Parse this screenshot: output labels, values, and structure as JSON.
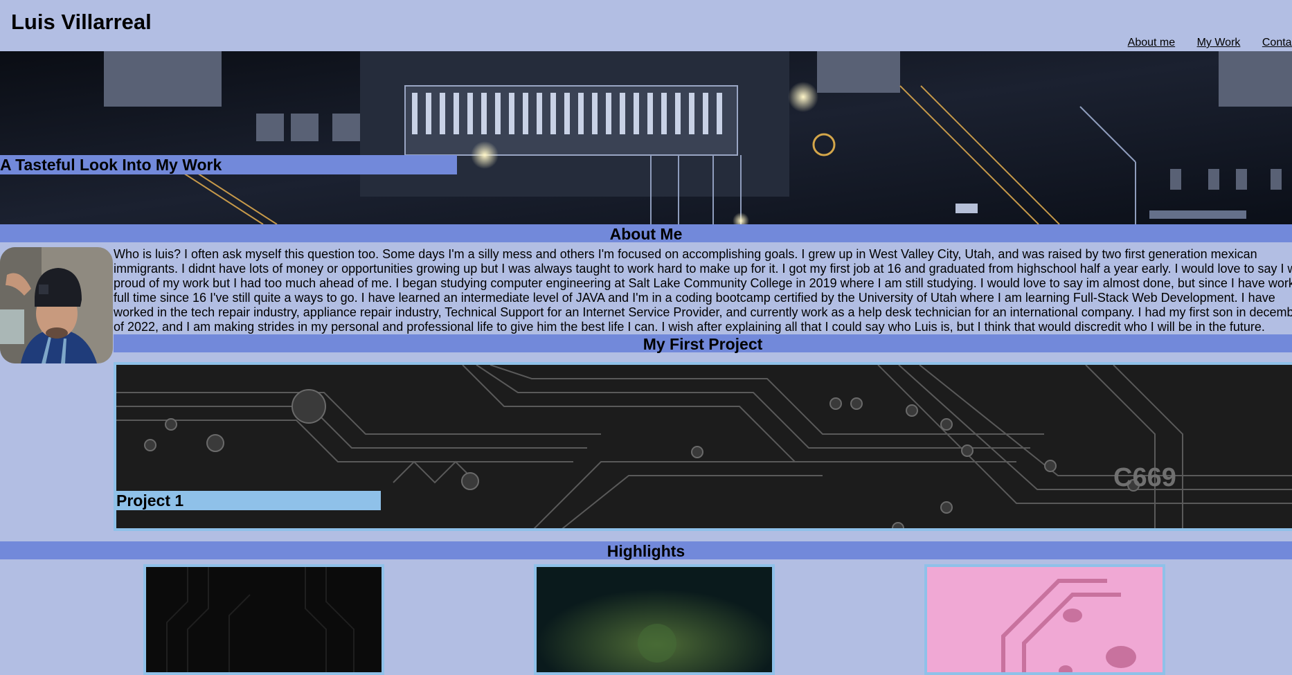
{
  "header": {
    "title": "Luis Villarreal",
    "nav": [
      {
        "label": "About me"
      },
      {
        "label": "My Work"
      },
      {
        "label": "Contacts"
      }
    ]
  },
  "hero": {
    "caption": "A Tasteful Look Into My Work"
  },
  "about": {
    "heading": "About Me",
    "lines": [
      "Who is luis? I often ask myself this question too. Some days I'm a silly mess and others I'm focused on accomplishing goals. I grew up in West Valley City, Utah, and was raised by two first generation mexican",
      "immigrants. I didnt have lots of money or opportunities growing up but I was always taught to work hard to make up for it. I got my first job at 16 and graduated from highschool half a year early. I would love to say I w",
      "proud of my work but I had too much ahead of me. I began studying computer engineering at Salt Lake Community College in 2019 where I am still studying. I would love to say im almost done, but since I have work",
      "full time since 16 I've still quite a ways to go. I have learned an intermediate level of JAVA and I'm in a coding bootcamp certified by the University of Utah where I am learning Full-Stack Web Development. I have",
      "worked in the tech repair industry, appliance repair industry, Technical Support for an Internet Service Provider, and currently work as a help desk technician for an international company. I had my first son in decemb",
      "of 2022, and I am making strides in my personal and professional life to give him the best life I can. I wish after explaining all that I could say who Luis is, but I think that would discredit who I will be in the future."
    ]
  },
  "project": {
    "heading": "My First Project",
    "label": "Project 1"
  },
  "highlights": {
    "heading": "Highlights"
  },
  "colors": {
    "background": "#b2bee3",
    "bar": "#7289da",
    "card_border": "#8fc1e9"
  },
  "icons": [
    "avatar-photo",
    "circuit-board-image"
  ]
}
